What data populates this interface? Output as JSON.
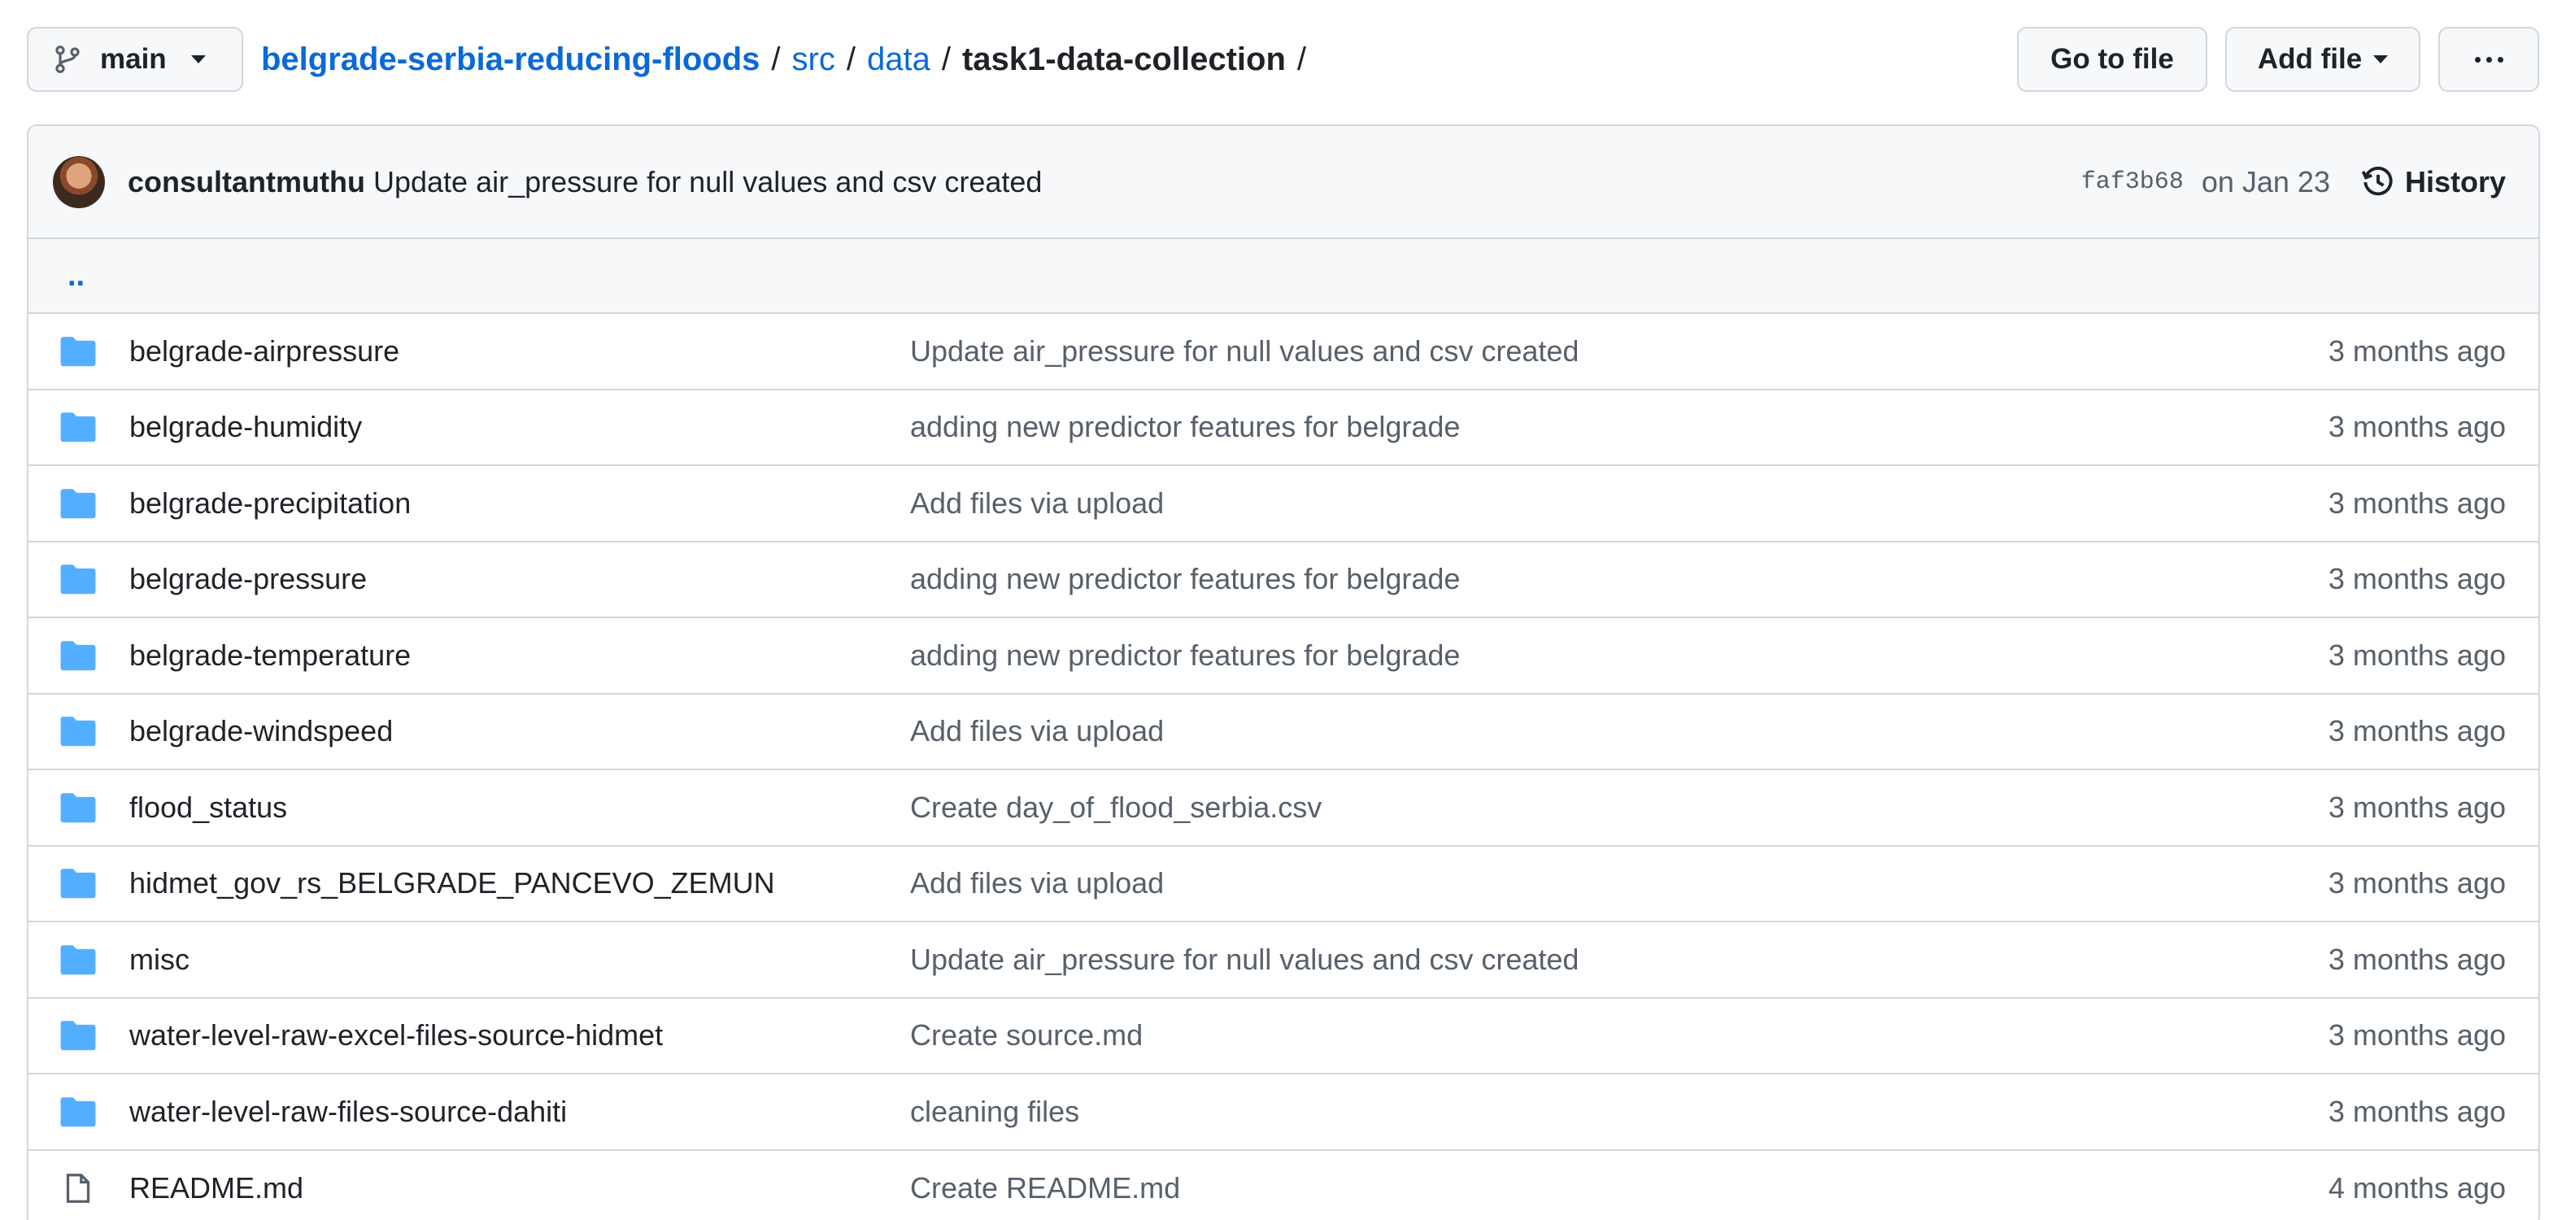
{
  "toolbar": {
    "branch": "main",
    "go_to_file": "Go to file",
    "add_file": "Add file"
  },
  "breadcrumb": {
    "repo": "belgrade-serbia-reducing-floods",
    "sep": "/",
    "src": "src",
    "data": "data",
    "current": "task1-data-collection"
  },
  "commit": {
    "author": "consultantmuthu",
    "message": "Update air_pressure for null values and csv created",
    "sha": "faf3b68",
    "date": "on Jan 23",
    "history_label": "History"
  },
  "parent_dir": "..",
  "files": [
    {
      "type": "folder",
      "name": "belgrade-airpressure",
      "message": "Update air_pressure for null values and csv created",
      "age": "3 months ago"
    },
    {
      "type": "folder",
      "name": "belgrade-humidity",
      "message": "adding new predictor features for belgrade",
      "age": "3 months ago"
    },
    {
      "type": "folder",
      "name": "belgrade-precipitation",
      "message": "Add files via upload",
      "age": "3 months ago"
    },
    {
      "type": "folder",
      "name": "belgrade-pressure",
      "message": "adding new predictor features for belgrade",
      "age": "3 months ago"
    },
    {
      "type": "folder",
      "name": "belgrade-temperature",
      "message": "adding new predictor features for belgrade",
      "age": "3 months ago"
    },
    {
      "type": "folder",
      "name": "belgrade-windspeed",
      "message": "Add files via upload",
      "age": "3 months ago"
    },
    {
      "type": "folder",
      "name": "flood_status",
      "message": "Create day_of_flood_serbia.csv",
      "age": "3 months ago"
    },
    {
      "type": "folder",
      "name": "hidmet_gov_rs_BELGRADE_PANCEVO_ZEMUN",
      "message": "Add files via upload",
      "age": "3 months ago"
    },
    {
      "type": "folder",
      "name": "misc",
      "message": "Update air_pressure for null values and csv created",
      "age": "3 months ago"
    },
    {
      "type": "folder",
      "name": "water-level-raw-excel-files-source-hidmet",
      "message": "Create source.md",
      "age": "3 months ago"
    },
    {
      "type": "folder",
      "name": "water-level-raw-files-source-dahiti",
      "message": "cleaning files",
      "age": "3 months ago"
    },
    {
      "type": "file",
      "name": "README.md",
      "message": "Create README.md",
      "age": "4 months ago"
    }
  ],
  "colors": {
    "link": "#0969da",
    "folder": "#54aeff",
    "muted": "#57606a",
    "border": "#d0d7de"
  }
}
